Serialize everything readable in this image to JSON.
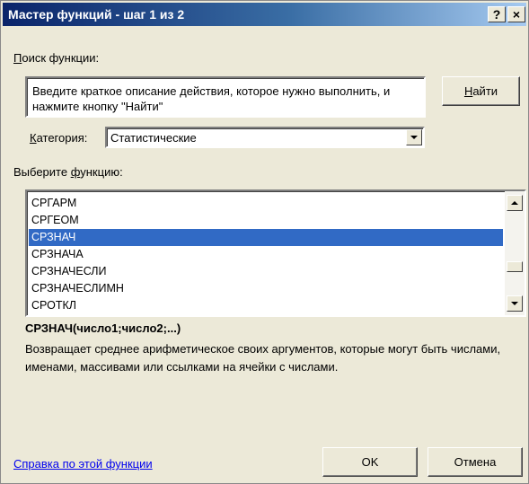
{
  "window": {
    "title": "Мастер функций - шаг 1 из 2",
    "help_glyph": "?",
    "close_glyph": "×"
  },
  "search": {
    "label_accel": "П",
    "label_rest": "оиск функции:",
    "value": "Введите краткое описание действия, которое нужно выполнить, и нажмите кнопку \"Найти\"",
    "find_accel": "Н",
    "find_rest": "айти"
  },
  "category": {
    "label_accel": "К",
    "label_rest": "атегория:",
    "value": "Статистические"
  },
  "function_list": {
    "label_pre": "Выберите ",
    "label_accel": "ф",
    "label_rest": "ункцию:",
    "items": [
      {
        "label": "СРГАРМ",
        "selected": false
      },
      {
        "label": "СРГЕОМ",
        "selected": false
      },
      {
        "label": "СРЗНАЧ",
        "selected": true
      },
      {
        "label": "СРЗНАЧА",
        "selected": false
      },
      {
        "label": "СРЗНАЧЕСЛИ",
        "selected": false
      },
      {
        "label": "СРЗНАЧЕСЛИМН",
        "selected": false
      },
      {
        "label": "СРОТКЛ",
        "selected": false
      }
    ]
  },
  "selected_function": {
    "signature": "СРЗНАЧ(число1;число2;...)",
    "description": "Возвращает среднее арифметическое своих аргументов, которые могут быть числами, именами, массивами или ссылками на ячейки с числами."
  },
  "footer": {
    "help_link": "Справка по этой функции",
    "ok_label": "OK",
    "cancel_label": "Отмена"
  },
  "colors": {
    "title_bar_start": "#0a246a",
    "title_bar_end": "#a6caf0",
    "selection": "#316ac5",
    "link": "#0000ee",
    "dialog_bg": "#ece9d8"
  }
}
